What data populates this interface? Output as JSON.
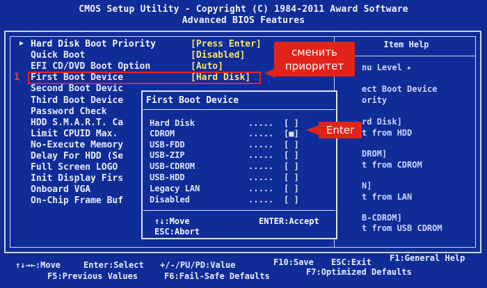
{
  "header": {
    "line1": "CMOS Setup Utility - Copyright (C) 1984-2011 Award Software",
    "line2": "Advanced BIOS Features"
  },
  "menu": [
    {
      "label": "Hard Disk Boot Priority",
      "value": "[Press Enter]",
      "submenu": true
    },
    {
      "label": "Quick Boot",
      "value": "[Disabled]"
    },
    {
      "label": "EFI CD/DVD Boot Option",
      "value": "[Auto]"
    },
    {
      "label": "First Boot Device",
      "value": "[Hard Disk]"
    },
    {
      "label": "Second Boot Devic",
      "value": ""
    },
    {
      "label": "Third Boot Device",
      "value": ""
    },
    {
      "label": "Password Check",
      "value": ""
    },
    {
      "label": "HDD S.M.A.R.T. Ca",
      "value": ""
    },
    {
      "label": "Limit CPUID Max.",
      "value": ""
    },
    {
      "label": "No-Execute Memory",
      "value": ""
    },
    {
      "label": "Delay For HDD (Se",
      "value": ""
    },
    {
      "label": "Full Screen LOGO",
      "value": ""
    },
    {
      "label": "Init Display Firs",
      "value": ""
    },
    {
      "label": "Onboard VGA",
      "value": ""
    },
    {
      "label": "On-Chip Frame Buf",
      "value": ""
    }
  ],
  "help": {
    "title": "Item Help",
    "lines": [
      "nu Level  ▸",
      "ect Boot Device",
      "ority",
      "rd Disk]",
      "t from HDD",
      "DROM]",
      "t from CDROM",
      "N]",
      "t from LAN",
      "B-CDROM]",
      "t from USB CDROM"
    ]
  },
  "popup": {
    "title": "First Boot Device",
    "options": [
      {
        "label": "Hard Disk",
        "dots": ".....",
        "mark": "[ ]"
      },
      {
        "label": "CDROM",
        "dots": ".....",
        "mark": "[■]"
      },
      {
        "label": "USB-FDD",
        "dots": ".....",
        "mark": "[ ]"
      },
      {
        "label": "USB-ZIP",
        "dots": ".....",
        "mark": "[ ]"
      },
      {
        "label": "USB-CDROM",
        "dots": ".....",
        "mark": "[ ]"
      },
      {
        "label": "USB-HDD",
        "dots": ".....",
        "mark": "[ ]"
      },
      {
        "label": "Legacy LAN",
        "dots": ".....",
        "mark": "[ ]"
      },
      {
        "label": "Disabled",
        "dots": ".....",
        "mark": "[ ]"
      }
    ],
    "hint_move": "↑↓:Move",
    "hint_accept": "ENTER:Accept",
    "hint_abort": "ESC:Abort"
  },
  "annotations": {
    "number": "1",
    "callout_priority": "сменить приоритет",
    "callout_enter": "Enter"
  },
  "footer": {
    "move": "↑↓→←:Move",
    "select": "Enter:Select",
    "value": "+/-/PU/PD:Value",
    "save": "F10:Save",
    "exit": "ESC:Exit",
    "help": "F1:General Help",
    "prev": "F5:Previous Values",
    "failsafe": "F6:Fail-Safe Defaults",
    "optimized": "F7:Optimized Defaults"
  },
  "colors": {
    "background": "#102c96",
    "value_yellow": "#f6e46a",
    "annotation_red": "#e2231a"
  }
}
